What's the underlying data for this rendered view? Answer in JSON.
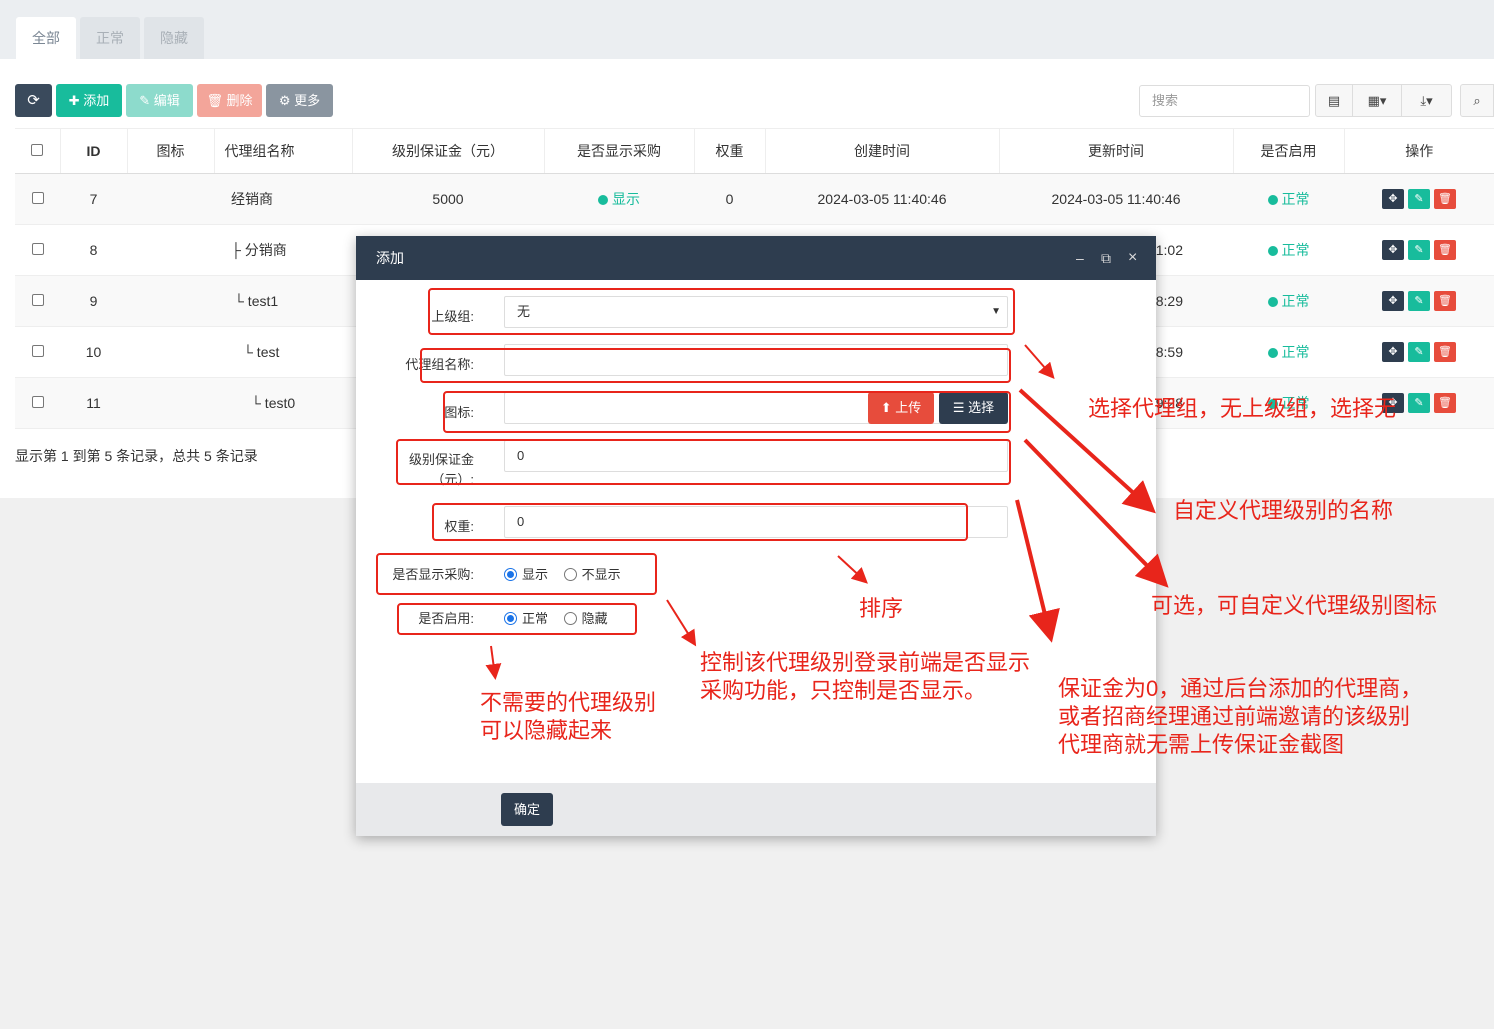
{
  "tabs": [
    "全部",
    "正常",
    "隐藏"
  ],
  "toolbar": {
    "refresh_label": "",
    "add_label": "✚ 添加",
    "edit_label": "✎ 编辑",
    "delete_label": "🗑 删除",
    "more_label": "⚙ 更多",
    "search_placeholder": "搜索"
  },
  "table": {
    "headers": [
      "ID",
      "图标",
      "代理组名称",
      "级别保证金（元）",
      "是否显示采购",
      "权重",
      "创建时间",
      "更新时间",
      "是否启用",
      "操作"
    ],
    "rows": [
      {
        "id": "7",
        "name": "经销商",
        "deposit": "5000",
        "show": "显示",
        "weight": "0",
        "created": "2024-03-05 11:40:46",
        "updated": "2024-03-05 11:40:46",
        "status": "正常"
      },
      {
        "id": "8",
        "name": "├ 分销商",
        "updated": "1:02",
        "status": "正常"
      },
      {
        "id": "9",
        "name": "└ test1",
        "updated": "8:29",
        "status": "正常"
      },
      {
        "id": "10",
        "name": "└ test",
        "updated": "8:59",
        "status": "正常"
      },
      {
        "id": "11",
        "name": "└ test0",
        "updated": "9:28",
        "status": "正常"
      }
    ]
  },
  "footer_text": "显示第 1 到第 5 条记录，总共 5 条记录",
  "modal": {
    "title": "添加",
    "parent_label": "上级组:",
    "parent_value": "无",
    "name_label": "代理组名称:",
    "icon_label": "图标:",
    "upload_label": "⬆ 上传",
    "select_label": "☰ 选择",
    "deposit_label_1": "级别保证金",
    "deposit_label_2": "（元）:",
    "deposit_value": "0",
    "weight_label": "权重:",
    "weight_value": "0",
    "show_label": "是否显示采购:",
    "show_opt_yes": "显示",
    "show_opt_no": "不显示",
    "enable_label": "是否启用:",
    "enable_opt_yes": "正常",
    "enable_opt_no": "隐藏",
    "confirm_label": "确定"
  },
  "annotations": {
    "parent_note": "选择代理组，无上级组，选择无",
    "name_note": "自定义代理级别的名称",
    "icon_note": "可选，可自定义代理级别图标",
    "weight_note": "排序",
    "show_note_1": "控制该代理级别登录前端是否显示",
    "show_note_2": "采购功能，只控制是否显示。",
    "enable_note_1": "不需要的代理级别",
    "enable_note_2": "可以隐藏起来",
    "deposit_note_1": "保证金为0，通过后台添加的代理商，",
    "deposit_note_2": "或者招商经理通过前端邀请的该级别",
    "deposit_note_3": "代理商就无需上传保证金截图"
  },
  "colors": {
    "accent": "#18bc9c",
    "dark": "#2e3d4f",
    "annotation": "#e8251b"
  }
}
